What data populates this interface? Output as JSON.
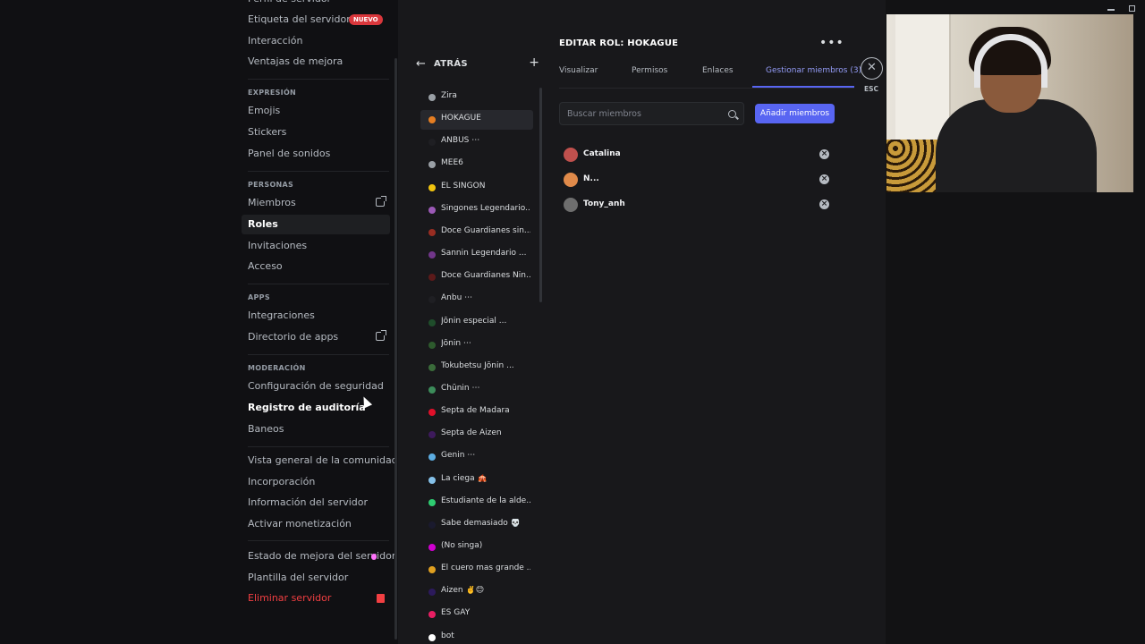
{
  "window": {
    "title_controls": [
      "minimize",
      "maximize"
    ]
  },
  "sidebar": {
    "items_top": [
      {
        "label": "Perfil de servidor"
      },
      {
        "label": "Etiqueta del servidor",
        "badge": "NUEVO"
      },
      {
        "label": "Interacción"
      },
      {
        "label": "Ventajas de mejora"
      }
    ],
    "expresion_header": "EXPRESIÓN",
    "expresion_items": [
      "Emojis",
      "Stickers",
      "Panel de sonidos"
    ],
    "personas_header": "PERSONAS",
    "personas_items": [
      "Miembros",
      "Roles",
      "Invitaciones",
      "Acceso"
    ],
    "apps_header": "APPS",
    "apps_items": [
      "Integraciones",
      "Directorio de apps"
    ],
    "moderacion_header": "MODERACIÓN",
    "moderacion_items": [
      "Configuración de seguridad",
      "Registro de auditoría",
      "Baneos"
    ],
    "community_items": [
      "Vista general de la comunidad",
      "Incorporación",
      "Información del servidor",
      "Activar monetización"
    ],
    "bottom_items": [
      "Estado de mejora del servidor",
      "Plantilla del servidor",
      "Eliminar servidor"
    ]
  },
  "roles_panel": {
    "back_label": "ATRÁS",
    "roles": [
      {
        "name": "Zira",
        "color": "#9aa0a6"
      },
      {
        "name": "HOKAGUE",
        "color": "#e67e22"
      },
      {
        "name": "ANBUS ⋯",
        "color": "#1f1f23"
      },
      {
        "name": "MEE6",
        "color": "#9aa0a6"
      },
      {
        "name": "EL SINGON",
        "color": "#f1c40f"
      },
      {
        "name": "Singones Legendario...",
        "color": "#9b59b6"
      },
      {
        "name": "Doce Guardianes sin...",
        "color": "#992d22"
      },
      {
        "name": "Sannin Legendario ...",
        "color": "#71368a"
      },
      {
        "name": "Doce Guardianes Nin...",
        "color": "#5c1a1a"
      },
      {
        "name": "Anbu ⋯",
        "color": "#1f1f23"
      },
      {
        "name": "Jōnin especial ...",
        "color": "#1f4d2b"
      },
      {
        "name": "Jōnin ⋯",
        "color": "#2d5a2d"
      },
      {
        "name": "Tokubetsu Jōnin ...",
        "color": "#3a6b3a"
      },
      {
        "name": "Chūnin ⋯",
        "color": "#3c8c5a"
      },
      {
        "name": "Septa de Madara",
        "color": "#e0102a"
      },
      {
        "name": "Septa de Aizen",
        "color": "#3d1a5c"
      },
      {
        "name": "Genin ⋯",
        "color": "#5dade2"
      },
      {
        "name": "La ciega 🎪",
        "color": "#85c1e9"
      },
      {
        "name": "Estudiante de la alde...",
        "color": "#2ecc71"
      },
      {
        "name": "Sabe demasiado 💀",
        "color": "#1a1a2e"
      },
      {
        "name": "(No singa)",
        "color": "#d000d0"
      },
      {
        "name": "El cuero mas grande ...",
        "color": "#e0a020"
      },
      {
        "name": "Aizen ✌️😊",
        "color": "#2c1a5c"
      },
      {
        "name": "ES GAY",
        "color": "#e91e63"
      },
      {
        "name": "bot",
        "color": "#ffffff"
      }
    ]
  },
  "editor": {
    "title": "EDITAR ROL: HOKAGUE",
    "tabs": [
      "Visualizar",
      "Permisos",
      "Enlaces",
      "Gestionar miembros (3)"
    ],
    "search_placeholder": "Buscar miembros",
    "add_button": "Añadir miembros",
    "members": [
      {
        "name": "Catalina",
        "avatar_color": "#c0504d"
      },
      {
        "name": "N...",
        "avatar_color": "#e08a4a"
      },
      {
        "name": "Tony_anh",
        "avatar_color": "#6e6e6e"
      }
    ]
  },
  "close": {
    "label": "ESC"
  }
}
